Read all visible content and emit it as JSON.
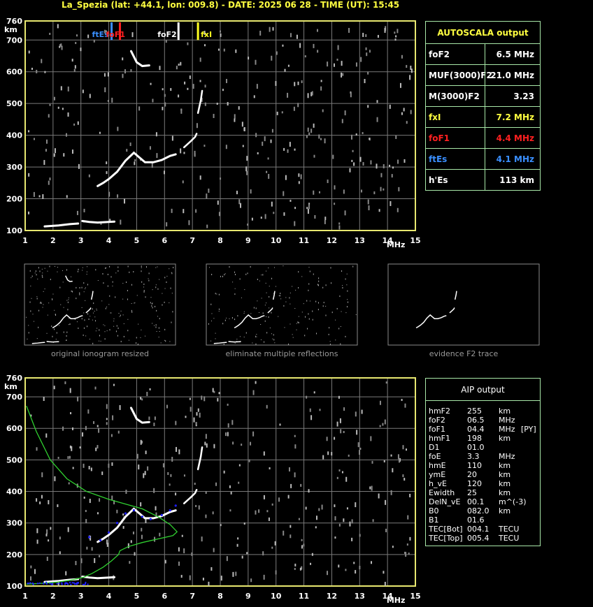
{
  "header": {
    "title": "La_Spezia (lat: +44.1, lon: 009.8) - DATE: 2025 06 28 - TIME (UT): 15:45"
  },
  "chart_data": {
    "type": "scatter",
    "xlabel": "MHz",
    "ylabel": "km",
    "xlim": [
      1,
      15
    ],
    "ylim": [
      100,
      760
    ],
    "x_ticks": [
      "1",
      "2",
      "3",
      "4",
      "5",
      "6",
      "7",
      "8",
      "9",
      "10",
      "11",
      "12",
      "13",
      "14",
      "15"
    ],
    "y_ticks": [
      "760",
      "700",
      "600",
      "500",
      "400",
      "300",
      "200",
      "100"
    ],
    "grid": true,
    "trace_F": [
      [
        3.6,
        240
      ],
      [
        3.8,
        250
      ],
      [
        4.0,
        262
      ],
      [
        4.3,
        285
      ],
      [
        4.6,
        320
      ],
      [
        4.9,
        345
      ],
      [
        5.1,
        330
      ],
      [
        5.3,
        315
      ],
      [
        5.6,
        315
      ],
      [
        5.9,
        322
      ],
      [
        6.2,
        335
      ],
      [
        6.4,
        340
      ]
    ],
    "trace_F_ext": [
      [
        6.7,
        362
      ],
      [
        6.95,
        382
      ],
      [
        7.1,
        395
      ],
      [
        7.15,
        405
      ]
    ],
    "trace_F_hi": [
      [
        7.2,
        470
      ],
      [
        7.3,
        510
      ],
      [
        7.35,
        540
      ]
    ],
    "trace_E": [
      [
        1.7,
        113
      ],
      [
        2.2,
        116
      ],
      [
        2.6,
        120
      ],
      [
        2.9,
        122
      ]
    ],
    "trace_Es": [
      [
        3.05,
        130
      ],
      [
        3.3,
        127
      ],
      [
        3.6,
        125
      ],
      [
        4.2,
        128
      ]
    ],
    "trace_mult": [
      [
        4.8,
        665
      ],
      [
        5.0,
        630
      ],
      [
        5.2,
        618
      ],
      [
        5.45,
        620
      ]
    ],
    "markers": [
      {
        "label": "ftEs",
        "freq": 4.1,
        "color": "#3a8fff"
      },
      {
        "label": "foF1",
        "freq": 4.4,
        "color": "#ff2020"
      },
      {
        "label": "foF2",
        "freq": 6.5,
        "color": "#ffffff"
      },
      {
        "label": "fxI",
        "freq": 7.2,
        "color": "#ffff20"
      }
    ],
    "profile_curve": [
      [
        1.05,
        670
      ],
      [
        1.4,
        590
      ],
      [
        1.9,
        500
      ],
      [
        2.5,
        440
      ],
      [
        3.2,
        400
      ],
      [
        4.0,
        375
      ],
      [
        4.6,
        360
      ],
      [
        5.2,
        345
      ],
      [
        5.8,
        318
      ],
      [
        6.2,
        295
      ],
      [
        6.45,
        272
      ],
      [
        6.3,
        260
      ],
      [
        5.8,
        250
      ],
      [
        5.2,
        238
      ],
      [
        4.7,
        225
      ],
      [
        4.4,
        212
      ],
      [
        4.35,
        200
      ],
      [
        4.1,
        180
      ],
      [
        3.8,
        160
      ],
      [
        3.4,
        140
      ],
      [
        3.1,
        128
      ],
      [
        2.6,
        118
      ],
      [
        2.1,
        112
      ],
      [
        1.5,
        108
      ],
      [
        1.05,
        106
      ]
    ],
    "profile_blue": [
      [
        3.3,
        255
      ],
      [
        3.7,
        245
      ],
      [
        4.0,
        270
      ],
      [
        4.3,
        300
      ],
      [
        4.6,
        330
      ],
      [
        4.9,
        340
      ],
      [
        5.2,
        320
      ],
      [
        5.5,
        312
      ],
      [
        5.9,
        325
      ],
      [
        6.2,
        340
      ],
      [
        6.4,
        355
      ]
    ]
  },
  "autoscala": {
    "title": "AUTOSCALA output",
    "rows": [
      {
        "label": "foF2",
        "value": "6.5 MHz",
        "color": "#ffffff"
      },
      {
        "label": "MUF(3000)F2",
        "value": "21.0 MHz",
        "color": "#ffffff"
      },
      {
        "label": "M(3000)F2",
        "value": "3.23",
        "color": "#ffffff"
      },
      {
        "label": "fxI",
        "value": "7.2 MHz",
        "color": "#ffff40"
      },
      {
        "label": "foF1",
        "value": "4.4 MHz",
        "color": "#ff2020"
      },
      {
        "label": "ftEs",
        "value": "4.1 MHz",
        "color": "#3a8fff"
      },
      {
        "label": "h'Es",
        "value": "113     km",
        "color": "#ffffff"
      }
    ]
  },
  "thumbs": [
    {
      "caption": "original ionogram resized"
    },
    {
      "caption": "eliminate multiple reflections"
    },
    {
      "caption": "evidence F2 trace"
    }
  ],
  "aip": {
    "title": "AIP output",
    "rows": [
      {
        "name": "hmF2",
        "value": "255",
        "unit": "km",
        "extra": ""
      },
      {
        "name": "foF2",
        "value": "06.5",
        "unit": "MHz",
        "extra": ""
      },
      {
        "name": "foF1",
        "value": "04.4",
        "unit": "MHz",
        "extra": "[PY]"
      },
      {
        "name": "hmF1",
        "value": "198",
        "unit": "km",
        "extra": ""
      },
      {
        "name": "D1",
        "value": "01.0",
        "unit": "",
        "extra": ""
      },
      {
        "name": "foE",
        "value": "3.3",
        "unit": "MHz",
        "extra": ""
      },
      {
        "name": "hmE",
        "value": "110",
        "unit": "km",
        "extra": ""
      },
      {
        "name": "ymE",
        "value": "20",
        "unit": "km",
        "extra": ""
      },
      {
        "name": "h_vE",
        "value": "120",
        "unit": "km",
        "extra": ""
      },
      {
        "name": "Ewidth",
        "value": "25",
        "unit": "km",
        "extra": ""
      },
      {
        "name": "DelN_vE",
        "value": "00.1",
        "unit": "m^(-3)",
        "extra": ""
      },
      {
        "name": "B0",
        "value": "082.0",
        "unit": "km",
        "extra": ""
      },
      {
        "name": "B1",
        "value": "01.6",
        "unit": "",
        "extra": ""
      },
      {
        "name": "TEC[Bot]",
        "value": "004.1",
        "unit": "TECU",
        "extra": ""
      },
      {
        "name": "TEC[Top]",
        "value": "005.4",
        "unit": "TECU",
        "extra": ""
      }
    ]
  },
  "colors": {
    "frame": "#e8e870",
    "grid": "#7a7a7a",
    "panel_border": "#a8e8a8",
    "profile": "#30d030",
    "profile_points": "#2020ff"
  }
}
